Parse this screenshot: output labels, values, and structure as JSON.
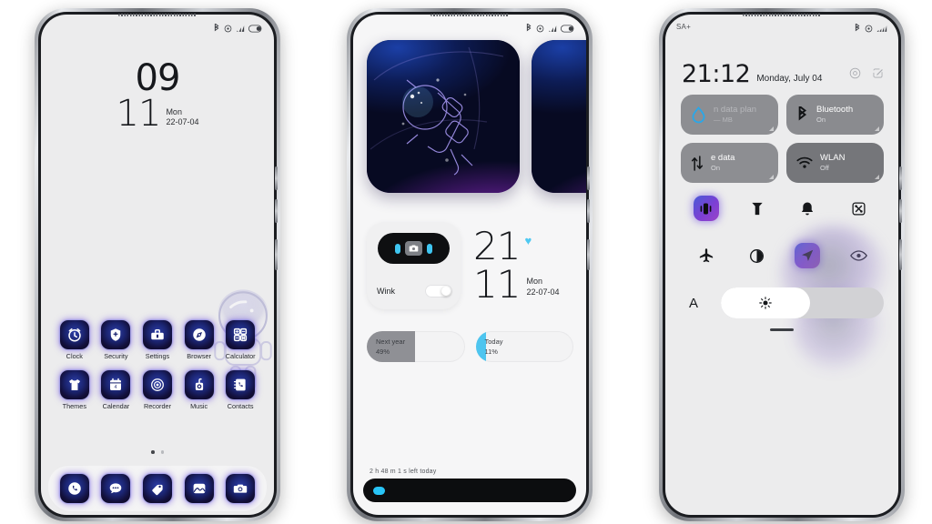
{
  "meta": {
    "background": "#ffffff",
    "accent_purple": "#7b3fd4",
    "accent_cyan": "#3fc6f2"
  },
  "phone1": {
    "statusbar": {
      "icons": [
        "bluetooth-icon",
        "alarm-icon",
        "signal-icon",
        "battery-icon"
      ]
    },
    "clock": {
      "hours": "09",
      "minutes": "11",
      "weekday": "Mon",
      "date": "22-07-04"
    },
    "apps": [
      {
        "label": "Clock",
        "icon": "clock-icon"
      },
      {
        "label": "Security",
        "icon": "shield-icon"
      },
      {
        "label": "Settings",
        "icon": "toolbox-icon"
      },
      {
        "label": "Browser",
        "icon": "compass-icon"
      },
      {
        "label": "Calculator",
        "icon": "calculator-icon"
      },
      {
        "label": "Themes",
        "icon": "tshirt-icon"
      },
      {
        "label": "Calendar",
        "icon": "calendar-icon"
      },
      {
        "label": "Recorder",
        "icon": "recorder-icon"
      },
      {
        "label": "Music",
        "icon": "music-icon"
      },
      {
        "label": "Contacts",
        "icon": "contacts-icon"
      }
    ],
    "calendar_day": "4",
    "pages": {
      "count": 2,
      "current": 1
    },
    "dock": [
      {
        "label": "Phone",
        "icon": "phone-icon"
      },
      {
        "label": "Messages",
        "icon": "message-icon"
      },
      {
        "label": "Gallery-tag",
        "icon": "tag-icon"
      },
      {
        "label": "Gallery",
        "icon": "photo-icon"
      },
      {
        "label": "Camera",
        "icon": "camera-icon"
      }
    ]
  },
  "phone2": {
    "statusbar": {
      "icons": [
        "bluetooth-icon",
        "alarm-icon",
        "signal-icon",
        "battery-icon"
      ]
    },
    "hero": {
      "title": "astronaut-illustration"
    },
    "wink": {
      "label": "Wink",
      "toggle_state": "on",
      "icon": "camera-icon"
    },
    "clock": {
      "hours": "21",
      "minutes": "11",
      "weekday": "Mon",
      "date": "22-07-04",
      "heart": "♥"
    },
    "progress": [
      {
        "label": "Next year",
        "value": "49%",
        "percent": 49,
        "color": "#8f9095"
      },
      {
        "label": "Today",
        "value": "11%",
        "percent": 11,
        "color": "#4ec5ef"
      }
    ],
    "screen_time_note": "2 h 48 m 1 s left today"
  },
  "phone3": {
    "statusbar": {
      "carrier": "SA+",
      "icons": [
        "bluetooth-icon",
        "alarm-icon",
        "signal-icon"
      ]
    },
    "header": {
      "time": "21:12",
      "date": "Monday, July 04",
      "actions": [
        "settings-gear-icon",
        "edit-icon"
      ]
    },
    "tiles": [
      {
        "title": "n data plan",
        "subtitle": "— MB",
        "icon": "data-drop-icon",
        "state": "on"
      },
      {
        "title": "Bluetooth",
        "subtitle": "On",
        "icon": "bluetooth-icon",
        "state": "on"
      },
      {
        "title": "e data",
        "subtitle": "On",
        "icon": "mobile-data-icon",
        "state": "on"
      },
      {
        "title": "WLAN",
        "subtitle": "Off",
        "icon": "wifi-icon",
        "state": "off"
      }
    ],
    "quick_toggles": [
      {
        "name": "vibrate-icon",
        "active": true
      },
      {
        "name": "flashlight-icon",
        "active": false
      },
      {
        "name": "bell-icon",
        "active": false
      },
      {
        "name": "screenshot-icon",
        "active": false
      },
      {
        "name": "airplane-icon",
        "active": false
      },
      {
        "name": "dark-mode-icon",
        "active": false
      },
      {
        "name": "location-icon",
        "active": true
      },
      {
        "name": "eye-care-icon",
        "active": false
      }
    ],
    "brightness": {
      "auto_label": "A",
      "percent": 55,
      "icon": "sun-icon"
    }
  }
}
